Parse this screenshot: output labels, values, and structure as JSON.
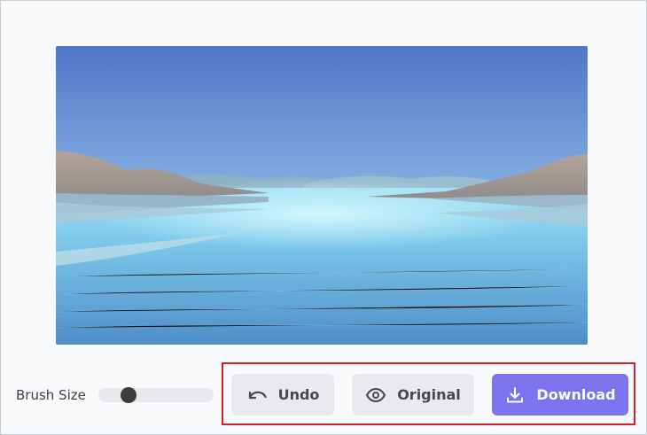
{
  "toolbar": {
    "brush_size_label": "Brush Size",
    "brush_size_value": 0.22,
    "undo_label": "Undo",
    "undo_icon": "undo-arrow-icon",
    "original_label": "Original",
    "original_icon": "eye-icon",
    "download_label": "Download",
    "download_icon": "download-icon"
  },
  "colors": {
    "download_bg": "#7e73ee",
    "secondary_bg": "#e9eaed",
    "highlight_border": "#d61f26"
  }
}
